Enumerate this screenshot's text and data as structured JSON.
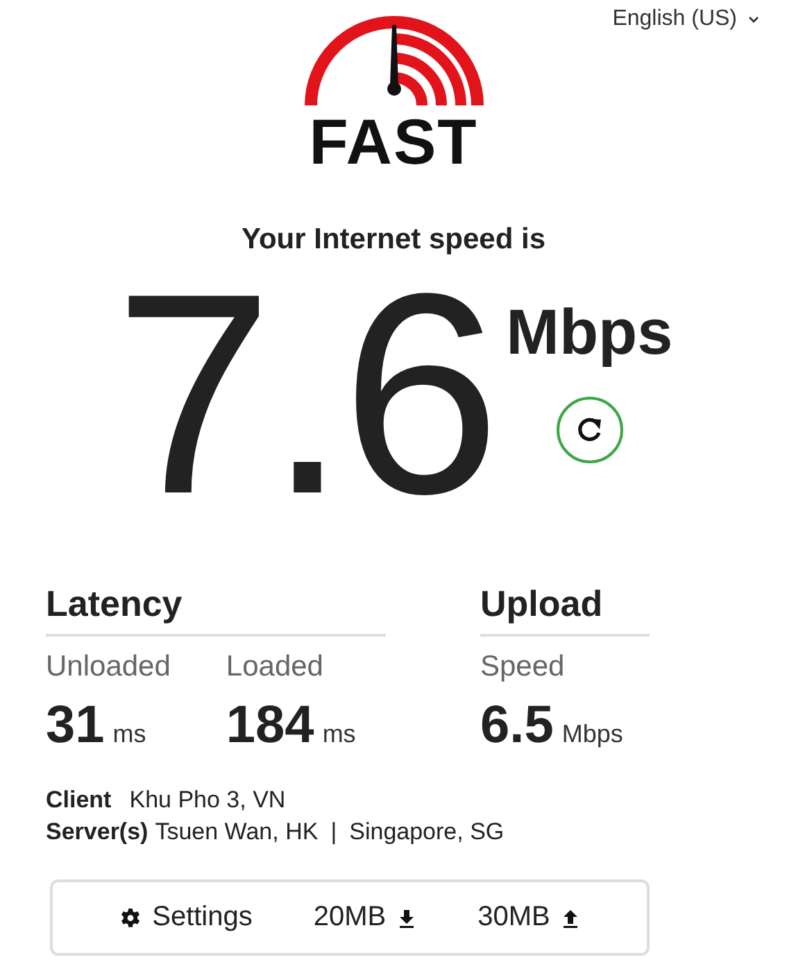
{
  "language": {
    "label": "English (US)"
  },
  "logo": {
    "text": "FAST"
  },
  "headline": "Your Internet speed is",
  "speed": {
    "value": "7.6",
    "unit": "Mbps"
  },
  "latency": {
    "title": "Latency",
    "metrics": [
      {
        "label": "Unloaded",
        "value": "31",
        "unit": "ms"
      },
      {
        "label": "Loaded",
        "value": "184",
        "unit": "ms"
      }
    ]
  },
  "upload": {
    "title": "Upload",
    "metrics": [
      {
        "label": "Speed",
        "value": "6.5",
        "unit": "Mbps"
      }
    ]
  },
  "client": {
    "label": "Client",
    "value": "Khu Pho 3, VN"
  },
  "servers": {
    "label": "Server(s)",
    "values": [
      "Tsuen Wan, HK",
      "Singapore, SG"
    ],
    "separator": "|"
  },
  "toolbar": [
    {
      "kind": "settings",
      "label": "Settings"
    },
    {
      "kind": "download",
      "label": "20MB"
    },
    {
      "kind": "upload",
      "label": "30MB"
    }
  ]
}
